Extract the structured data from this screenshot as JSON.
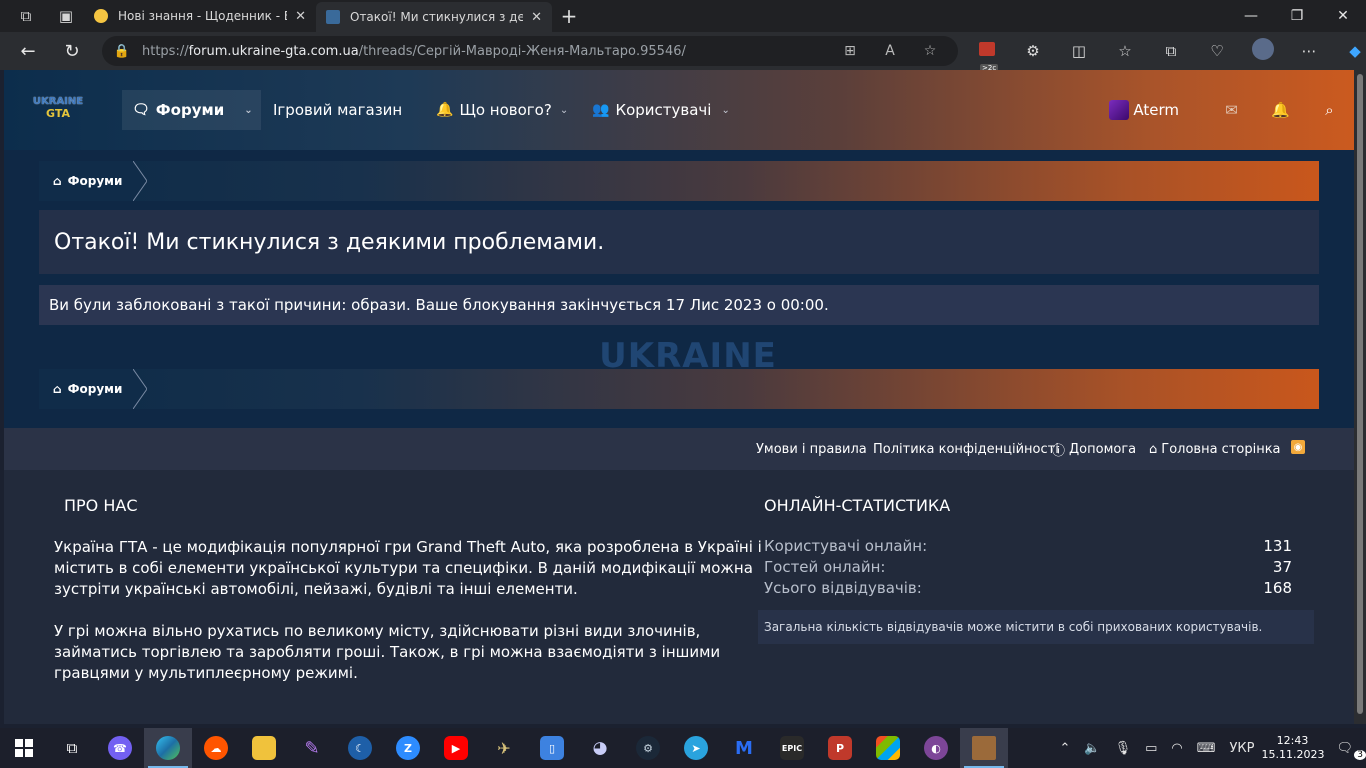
{
  "browser": {
    "tabs": [
      {
        "title": "Нові знання - Щоденник - Елект",
        "active": false
      },
      {
        "title": "Отакої! Ми стикнулися з деяким",
        "active": true
      }
    ],
    "url_scheme": "https://",
    "url_host": "forum.ukraine-gta.com.ua",
    "url_path": "/threads/Сергій-Мавроді-Женя-Мальтаро.95546/",
    "ext_badge": ">2с"
  },
  "site": {
    "logo_top": "UKRAINE",
    "logo_bottom": "GTA",
    "nav": {
      "forums": "Форуми",
      "shop": "Ігровий магазин",
      "whats_new": "Що нового?",
      "users": "Користувачі"
    },
    "username": "Aterm"
  },
  "breadcrumb": {
    "home_label": "Форуми"
  },
  "error": {
    "title": "Отакої! Ми стикнулися з деякими проблемами.",
    "message": "Ви були заблоковані з такої причини: образи. Ваше блокування закінчується 17 Лис 2023 о 00:00."
  },
  "watermark": {
    "top": "UKRAINE",
    "bottom": "GTA"
  },
  "footer_links": {
    "terms": "Умови і правила",
    "privacy": "Політика конфіденційності",
    "help": "Допомога",
    "home": "Головна сторінка"
  },
  "about": {
    "heading": "ПРО НАС",
    "para1_l1": "Україна ГТА - це модифікація популярної гри Grand Theft Auto, яка розроблена в Україні і",
    "para1_l2": "містить в собі елементи української культури та специфіки. В даній модифікації можна",
    "para1_l3": "зустріти українські автомобілі, пейзажі, будівлі та інші елементи.",
    "para2_l1": "У грі можна вільно рухатись по великому місту, здійснювати різні види злочинів,",
    "para2_l2": "займатись торгівлею та заробляти гроші. Також, в грі можна взаємодіяти з іншими",
    "para2_l3": "гравцями у мультиплеєрному режимі."
  },
  "stats": {
    "heading": "ОНЛАЙН-СТАТИСТИКА",
    "rows": [
      {
        "label": "Користувачі онлайн:",
        "value": "131"
      },
      {
        "label": "Гостей онлайн:",
        "value": "37"
      },
      {
        "label": "Усього відвідувачів:",
        "value": "168"
      }
    ],
    "note": "Загальна кількість відвідувачів може містити в собі прихованих користувачів."
  },
  "taskbar": {
    "lang": "УКР",
    "time": "12:43",
    "date": "15.11.2023",
    "notif_count": "3",
    "epic_label": "EPIC"
  },
  "colors": {
    "accent_orange": "#c9571c",
    "page_bg": "#0f2845",
    "footer_bg": "#222a3b",
    "rss": "#f2a93b"
  }
}
